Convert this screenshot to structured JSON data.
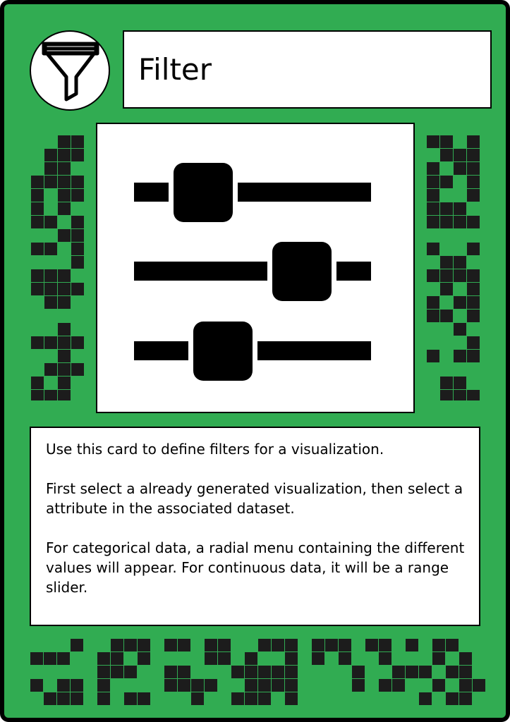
{
  "card": {
    "title": "Filter",
    "title_icon": "funnel-icon",
    "illustration_icon": "sliders-icon",
    "background_color": "#31ac52",
    "description": [
      "Use this card to define filters for a visualization.",
      "First select a already generated visualization, then select a attribute in the associated dataset.",
      "For categorical data, a radial menu containing the different values will appear. For continuous data, it will be a range slider."
    ]
  }
}
